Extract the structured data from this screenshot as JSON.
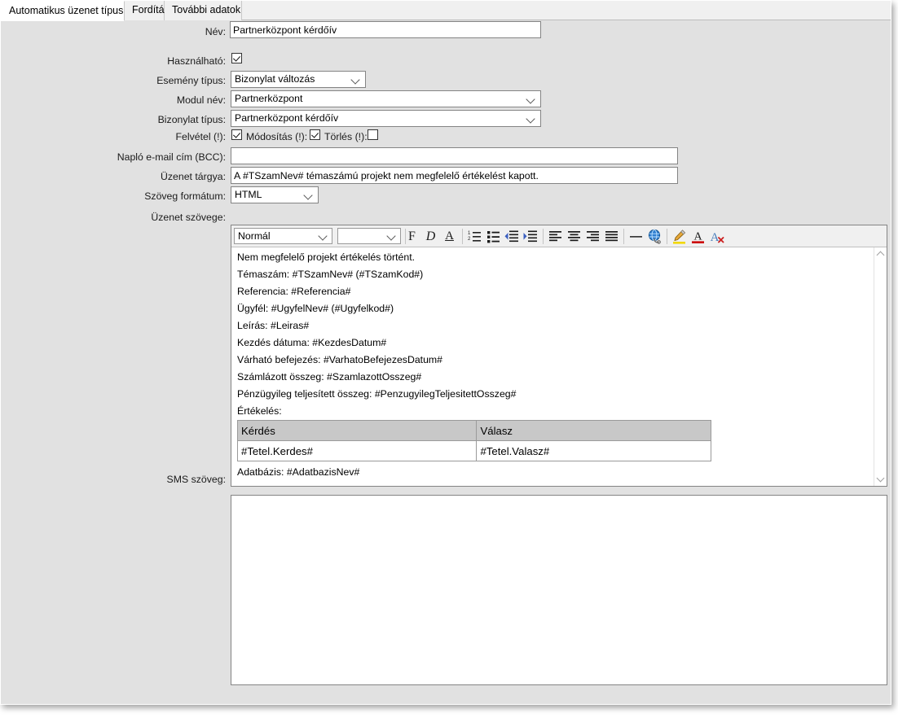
{
  "window": {
    "tabs": [
      {
        "label": "Automatikus üzenet típus",
        "active": true
      },
      {
        "label": "Fordítás",
        "active": false
      },
      {
        "label": "További adatok",
        "active": false
      }
    ]
  },
  "form": {
    "name": {
      "label": "Név:",
      "value": "Partnerközpont kérdőív"
    },
    "usable": {
      "label": "Használható:",
      "checked": true
    },
    "event_type": {
      "label": "Esemény típus:",
      "value": "Bizonylat változás"
    },
    "module_name": {
      "label": "Modul név:",
      "value": "Partnerközpont"
    },
    "document_type": {
      "label": "Bizonylat típus:",
      "value": "Partnerközpont kérdőív"
    },
    "insert": {
      "label": "Felvétel (!):",
      "checked": true
    },
    "modify": {
      "label": "Módosítás (!):",
      "checked": true
    },
    "delete": {
      "label": "Törlés (!):",
      "checked": false
    },
    "log_email_bcc": {
      "label": "Napló e-mail cím (BCC):",
      "value": ""
    },
    "subject": {
      "label": "Üzenet tárgya:",
      "value": "A #TSzamNev# témaszámú projekt nem megfelelő értékelést kapott."
    },
    "text_format": {
      "label": "Szöveg formátum:",
      "value": "HTML"
    },
    "message_body": {
      "label": "Üzenet szövege:"
    },
    "sms_text": {
      "label": "SMS szöveg:",
      "value": ""
    }
  },
  "editor": {
    "toolbar": {
      "style_combo": "Normál",
      "font_combo": "",
      "buttons": [
        {
          "name": "bold-button",
          "glyph": "F"
        },
        {
          "name": "italic-button",
          "glyph": "D"
        },
        {
          "name": "underline-button",
          "glyph": "A"
        },
        {
          "name": "numbered-list-button",
          "glyph": ""
        },
        {
          "name": "bullet-list-button",
          "glyph": ""
        },
        {
          "name": "decrease-indent-button",
          "glyph": ""
        },
        {
          "name": "increase-indent-button",
          "glyph": ""
        },
        {
          "name": "align-left-button",
          "glyph": ""
        },
        {
          "name": "align-center-button",
          "glyph": ""
        },
        {
          "name": "align-right-button",
          "glyph": ""
        },
        {
          "name": "align-justify-button",
          "glyph": ""
        },
        {
          "name": "horizontal-rule-button",
          "glyph": ""
        },
        {
          "name": "hyperlink-button",
          "glyph": ""
        },
        {
          "name": "highlight-color-button",
          "glyph": ""
        },
        {
          "name": "font-color-button",
          "glyph": ""
        },
        {
          "name": "clear-formatting-button",
          "glyph": ""
        }
      ]
    },
    "content_lines_top": [
      "Nem megfelelő projekt értékelés történt.",
      "Témaszám: #TSzamNev# (#TSzamKod#)",
      "Referencia: #Referencia#",
      "Ügyfél: #UgyfelNev# (#Ugyfelkod#)",
      "Leírás: #Leiras#",
      "Kezdés dátuma: #KezdesDatum#",
      "Várható befejezés: #VarhatoBefejezesDatum#",
      "Számlázott összeg: #SzamlazottOsszeg#",
      "Pénzügyileg teljesített összeg: #PenzugyilegTeljesitettOsszeg#",
      "Értékelés:"
    ],
    "table": {
      "headers": [
        "Kérdés",
        "Válasz"
      ],
      "rows": [
        [
          "#Tetel.Kerdes#",
          "#Tetel.Valasz#"
        ]
      ]
    },
    "content_lines_bottom": [
      "Adatbázis: #AdatbazisNev#"
    ]
  },
  "colors": {
    "window_bg": "#e1e1e1",
    "tab_bg": "#f0f0f0",
    "tab_active_bg": "#ffffff",
    "field_border": "#848484",
    "table_header_bg": "#c8c8c8",
    "indent_arrow": "#3b5fc0",
    "highlight_yellow": "#f2d800",
    "font_color_red": "#cc0000",
    "clear_format_blue": "#4a7ebb"
  }
}
